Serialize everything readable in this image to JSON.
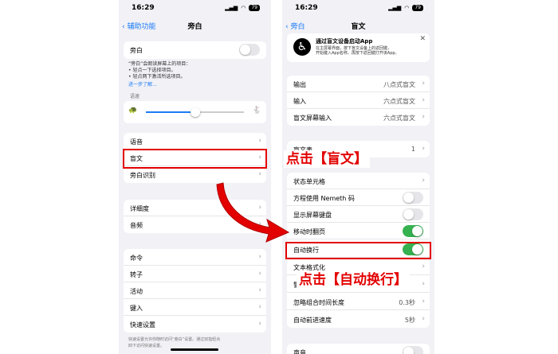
{
  "left": {
    "time": "16:29",
    "battery": "79",
    "back_label": "辅助功能",
    "title": "旁白",
    "voiceover_label": "旁白",
    "desc": [
      "“旁白”会朗读屏幕上的项目：",
      "• 轻点一下选择项目。",
      "• 轻点两下激活所选项目。"
    ],
    "learn_more": "进一步了解…",
    "speech_rate_label": "语速",
    "speech_rate_value": 0.5,
    "group1": [
      "语音",
      "盲文",
      "旁白识别"
    ],
    "group2": [
      "详细度",
      "音频"
    ],
    "group3": [
      "命令",
      "转子",
      "活动",
      "键入",
      "快速设置"
    ],
    "footer": [
      "快速设置允许你随时访问“旁白”设置。通过双指轻点",
      "四下访问快速设置。"
    ]
  },
  "right": {
    "time": "16:29",
    "battery": "79",
    "back_label": "旁白",
    "title": "盲文",
    "banner_title": "通过盲文设备启动App",
    "banner_text": [
      "在主屏幕界面，按下盲文设备上的返回键，",
      "开始键入App名称，再按下返回键打开该App。"
    ],
    "rows1": [
      {
        "label": "输出",
        "value": "八点式盲文"
      },
      {
        "label": "输入",
        "value": "六点式盲文"
      },
      {
        "label": "盲文屏幕输入",
        "value": "六点式盲文"
      }
    ],
    "partial_row_label": "盲文表",
    "partial_row_value": "1",
    "rows2": [
      {
        "label": "状态单元格",
        "type": "chevron"
      },
      {
        "label": "方程使用 Nemeth 码",
        "type": "toggle",
        "on": false
      },
      {
        "label": "显示屏幕键盘",
        "type": "toggle",
        "on": false
      },
      {
        "label": "移动时翻页",
        "type": "toggle",
        "on": true
      },
      {
        "label": "自动换行",
        "type": "toggle",
        "on": true
      },
      {
        "label": "文本格式化",
        "type": "chevron"
      },
      {
        "label": "警告",
        "type": "chevron"
      },
      {
        "label": "忽略组合时间长度",
        "type": "value",
        "value": "0.3秒"
      },
      {
        "label": "自动前进速度",
        "type": "value",
        "value": "5秒"
      }
    ],
    "sound_label": "声音"
  },
  "callouts": {
    "braille": "点击【盲文】",
    "auto_wrap": "点击【自动换行】"
  },
  "colors": {
    "highlight": "#e30000",
    "toggle_on": "#35b150",
    "link": "#1d7cf6"
  }
}
